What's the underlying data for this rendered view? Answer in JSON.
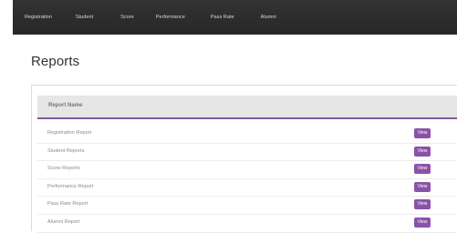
{
  "nav": {
    "items": [
      "Registration",
      "Student",
      "Score",
      "Performance",
      "Pass Rate",
      "Alumni"
    ]
  },
  "page": {
    "title": "Reports"
  },
  "table": {
    "header": "Report Name",
    "rows": [
      {
        "name": "Registration Report",
        "action": "View"
      },
      {
        "name": "Student Reports",
        "action": "View"
      },
      {
        "name": "Score Reports",
        "action": "View"
      },
      {
        "name": "Performance Report",
        "action": "View"
      },
      {
        "name": "Pass Rate Report",
        "action": "View"
      },
      {
        "name": "Alumni Report",
        "action": "View"
      }
    ]
  },
  "colors": {
    "nav_bg": "#2e2e2e",
    "accent": "#8a52a8",
    "header_bg": "#e6e6e6"
  }
}
